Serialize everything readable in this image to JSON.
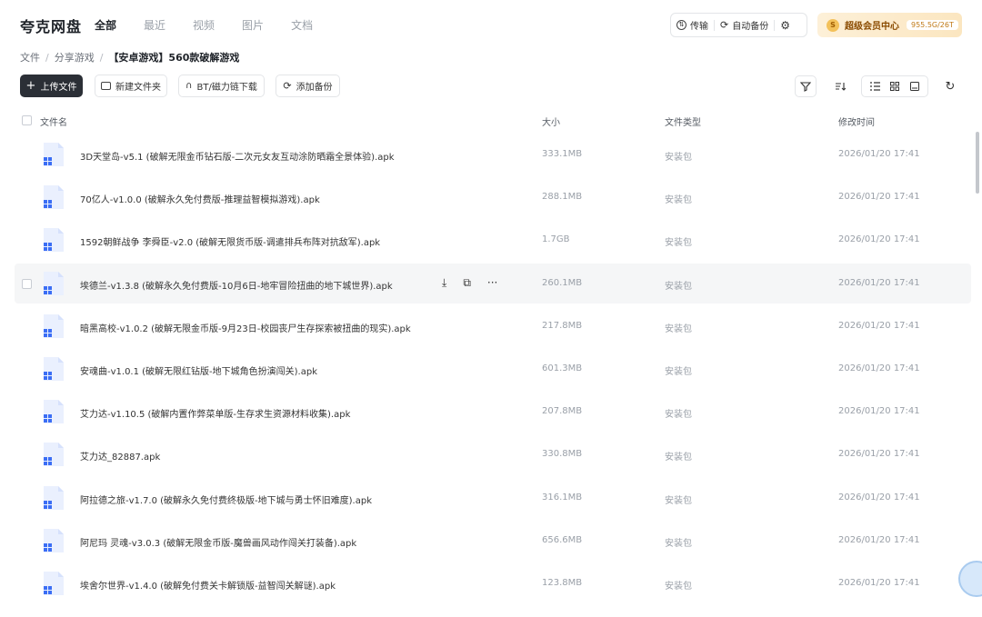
{
  "app": {
    "title": "夸克网盘"
  },
  "nav": {
    "tabs": [
      {
        "label": "全部"
      },
      {
        "label": "最近"
      },
      {
        "label": "视频"
      },
      {
        "label": "图片"
      },
      {
        "label": "文档"
      }
    ]
  },
  "top_actions": {
    "transfer_label": "传输",
    "auto_backup_label": "自动备份"
  },
  "vip": {
    "badge": "S",
    "label": "超级会员中心",
    "storage": "955.5G/26T"
  },
  "breadcrumb": {
    "items": [
      "文件",
      "分享游戏",
      "【安卓游戏】560款破解游戏"
    ],
    "separator": "/"
  },
  "toolbar": {
    "upload_label": "上传文件",
    "new_folder_label": "新建文件夹",
    "bt_label": "BT/磁力链下载",
    "add_backup_label": "添加备份"
  },
  "table": {
    "headers": {
      "name": "文件名",
      "size": "大小",
      "type": "文件类型",
      "mtime": "修改时间"
    },
    "rows": [
      {
        "name": "3D天堂岛-v5.1 (破解无限金币钻石版-二次元女友互动涂防晒霜全景体验).apk",
        "size": "333.1MB",
        "type": "安装包",
        "mtime": "2026/01/20 17:41"
      },
      {
        "name": "70亿人-v1.0.0 (破解永久免付费版-推理益智模拟游戏).apk",
        "size": "288.1MB",
        "type": "安装包",
        "mtime": "2026/01/20 17:41"
      },
      {
        "name": "1592朝鲜战争 李舜臣-v2.0 (破解无限货币版-调遣排兵布阵对抗敌军).apk",
        "size": "1.7GB",
        "type": "安装包",
        "mtime": "2026/01/20 17:41"
      },
      {
        "name": "埃德兰-v1.3.8 (破解永久免付费版-10月6日-地牢冒险扭曲的地下城世界).apk",
        "size": "260.1MB",
        "type": "安装包",
        "mtime": "2026/01/20 17:41"
      },
      {
        "name": "暗黑高校-v1.0.2 (破解无限金币版-9月23日-校园丧尸生存探索被扭曲的现实).apk",
        "size": "217.8MB",
        "type": "安装包",
        "mtime": "2026/01/20 17:41"
      },
      {
        "name": "安魂曲-v1.0.1 (破解无限红钻版-地下城角色扮演闯关).apk",
        "size": "601.3MB",
        "type": "安装包",
        "mtime": "2026/01/20 17:41"
      },
      {
        "name": "艾力达-v1.10.5 (破解内置作弊菜单版-生存求生资源材料收集).apk",
        "size": "207.8MB",
        "type": "安装包",
        "mtime": "2026/01/20 17:41"
      },
      {
        "name": "艾力达_82887.apk",
        "size": "330.8MB",
        "type": "安装包",
        "mtime": "2026/01/20 17:41"
      },
      {
        "name": "阿拉德之旅-v1.7.0 (破解永久免付费终极版-地下城与勇士怀旧难度).apk",
        "size": "316.1MB",
        "type": "安装包",
        "mtime": "2026/01/20 17:41"
      },
      {
        "name": "阿尼玛 灵魂-v3.0.3 (破解无限金币版-魔兽画风动作闯关打装备).apk",
        "size": "656.6MB",
        "type": "安装包",
        "mtime": "2026/01/20 17:41"
      },
      {
        "name": "埃舍尔世界-v1.4.0 (破解免付费关卡解锁版-益智闯关解谜).apk",
        "size": "123.8MB",
        "type": "安装包",
        "mtime": "2026/01/20 17:41"
      }
    ]
  },
  "icons": {
    "upload": "plus-icon",
    "new_folder": "folder-plus-icon",
    "bt": "magnet-icon",
    "backup": "sync-icon",
    "filter": "filter-icon",
    "sort": "sort-icon",
    "list_view": "list-view-icon",
    "grid_view": "grid-view-icon",
    "preview_view": "preview-view-icon",
    "refresh": "refresh-icon",
    "file": "apk-file-icon"
  },
  "colors": {
    "primary_button": "#2b2f36",
    "vip_gold": "#f3c15a",
    "file_icon_blue": "#3b6ef5",
    "hover_row": "#f5f6f7"
  }
}
